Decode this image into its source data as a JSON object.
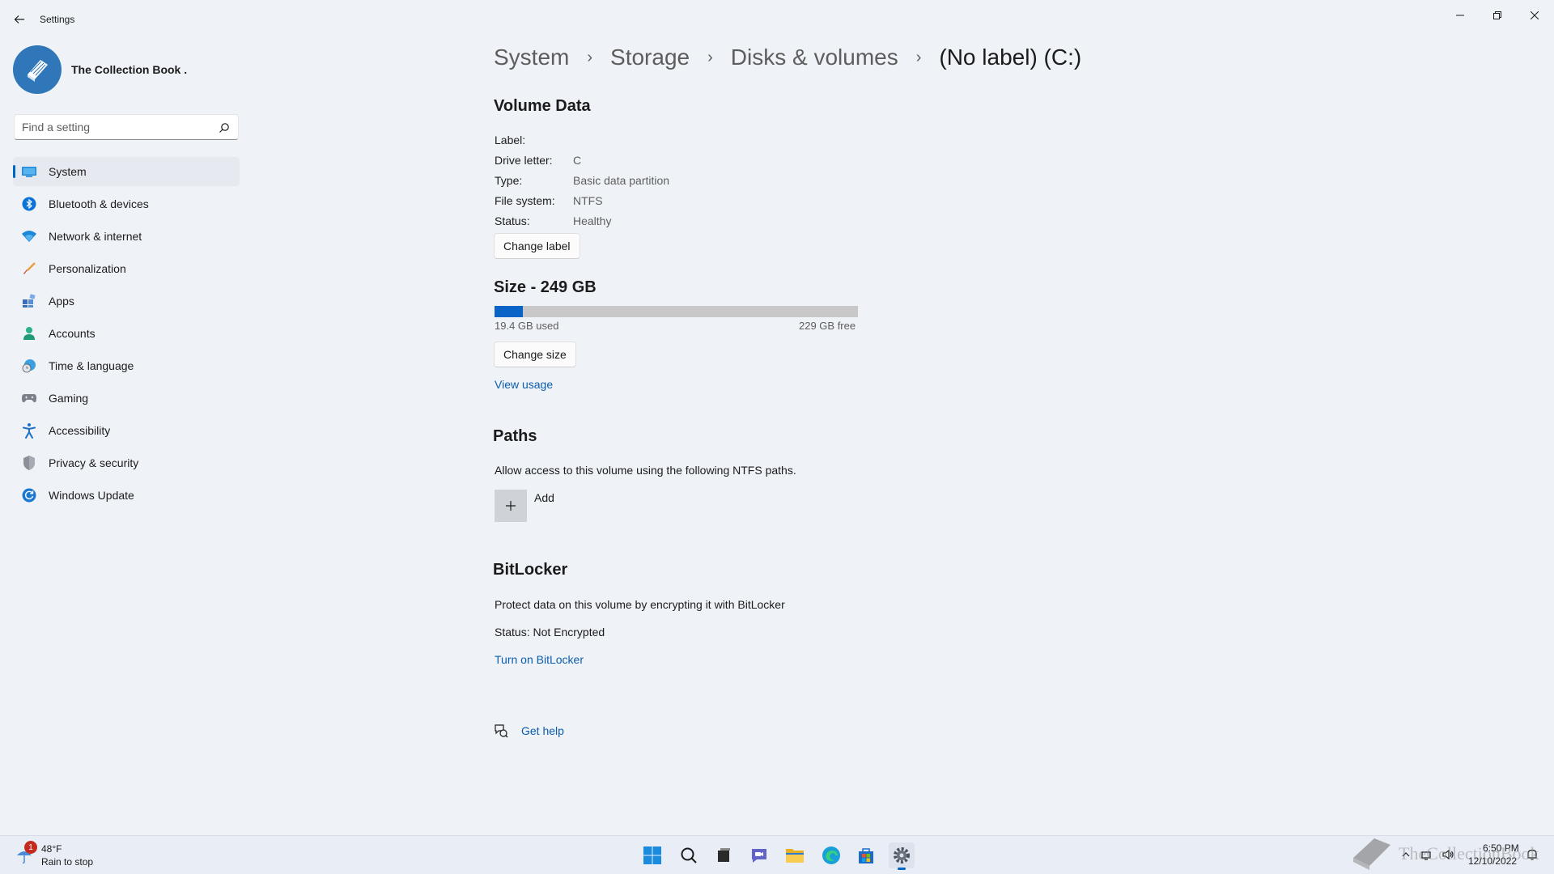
{
  "window": {
    "title": "Settings"
  },
  "profile": {
    "name": "The Collection Book ."
  },
  "search": {
    "placeholder": "Find a setting"
  },
  "sidebar": {
    "items": [
      {
        "label": "System",
        "icon": "system-icon",
        "selected": true
      },
      {
        "label": "Bluetooth & devices",
        "icon": "bluetooth-icon"
      },
      {
        "label": "Network & internet",
        "icon": "wifi-icon"
      },
      {
        "label": "Personalization",
        "icon": "brush-icon"
      },
      {
        "label": "Apps",
        "icon": "apps-icon"
      },
      {
        "label": "Accounts",
        "icon": "accounts-icon"
      },
      {
        "label": "Time & language",
        "icon": "clock-globe-icon"
      },
      {
        "label": "Gaming",
        "icon": "controller-icon"
      },
      {
        "label": "Accessibility",
        "icon": "accessibility-icon"
      },
      {
        "label": "Privacy & security",
        "icon": "shield-icon"
      },
      {
        "label": "Windows Update",
        "icon": "update-icon"
      }
    ]
  },
  "breadcrumb": {
    "items": [
      "System",
      "Storage",
      "Disks & volumes",
      "(No label) (C:)"
    ]
  },
  "volume_data": {
    "title": "Volume Data",
    "rows": [
      {
        "label": "Label:",
        "value": ""
      },
      {
        "label": "Drive letter:",
        "value": "C"
      },
      {
        "label": "Type:",
        "value": "Basic data partition"
      },
      {
        "label": "File system:",
        "value": "NTFS"
      },
      {
        "label": "Status:",
        "value": "Healthy"
      }
    ],
    "change_label_button": "Change label"
  },
  "size": {
    "title": "Size - 249 GB",
    "used_text": "19.4 GB used",
    "free_text": "229 GB free",
    "used_fraction": 0.078,
    "change_size_button": "Change size",
    "view_usage_link": "View usage"
  },
  "paths": {
    "title": "Paths",
    "description": "Allow access to this volume using the following NTFS paths.",
    "add_label": "Add"
  },
  "bitlocker": {
    "title": "BitLocker",
    "description": "Protect data on this volume by encrypting it with BitLocker",
    "status": "Status: Not Encrypted",
    "turn_on_link": "Turn on BitLocker"
  },
  "help": {
    "label": "Get help"
  },
  "taskbar": {
    "weather_temp": "48°F",
    "weather_desc": "Rain to stop",
    "weather_badge": "1",
    "apps": [
      "start-icon",
      "search-icon",
      "task-view-icon",
      "chat-icon",
      "file-explorer-icon",
      "edge-icon",
      "store-icon",
      "settings-icon"
    ],
    "clock_time": "6:50 PM",
    "clock_date": "12/10/2022",
    "watermark": "TheCollectionBook"
  },
  "colors": {
    "accent": "#0067c0",
    "link": "#0b5cad",
    "usage_fill": "#0a64c8"
  }
}
